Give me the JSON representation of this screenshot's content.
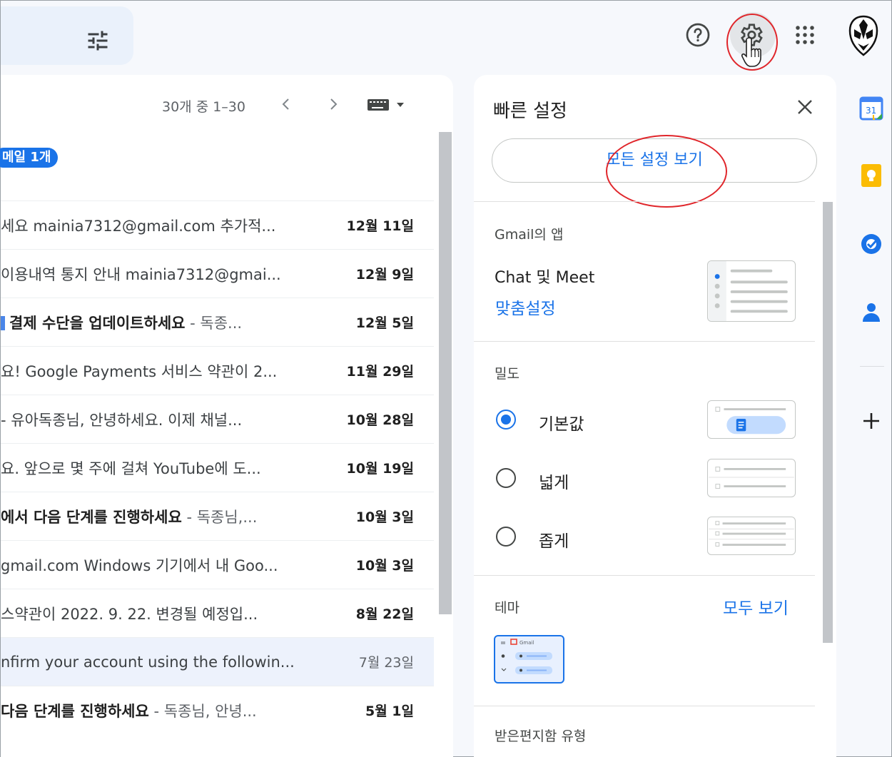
{
  "header": {
    "icons": [
      "tune-icon",
      "help-icon",
      "settings-gear-icon",
      "apps-grid-icon",
      "account-avatar"
    ]
  },
  "mail_list": {
    "pager_text": "30개 중 1–30",
    "new_badge": "메일 1개",
    "rows": [
      {
        "subject": "세요 mainia7312@gmail.com 추가적...",
        "date": "12월 11일",
        "bold": false,
        "highlight": false
      },
      {
        "subject": "이용내역 통지 안내 mainia7312@gmai...",
        "date": "12월 9일",
        "bold": false,
        "highlight": false
      },
      {
        "subject": "결제 수단을 업데이트하세요",
        "snippet": " - 독종...",
        "date": "12월 5일",
        "bold": true,
        "tag": true,
        "highlight": false
      },
      {
        "subject": "요! Google Payments 서비스 약관이 2...",
        "date": "11월 29일",
        "bold": false,
        "highlight": false
      },
      {
        "subject": "- 유아독종님, 안녕하세요. 이제 채널...",
        "date": "10월 28일",
        "bold": false,
        "highlight": false
      },
      {
        "subject": "요. 앞으로 몇 주에 걸쳐 YouTube에 도...",
        "date": "10월 19일",
        "bold": false,
        "highlight": false
      },
      {
        "subject": "에서 다음 단계를 진행하세요",
        "snippet": " - 독종님,...",
        "date": "10월 3일",
        "bold": true,
        "highlight": false
      },
      {
        "subject": "gmail.com Windows 기기에서 내 Goo...",
        "date": "10월 3일",
        "bold": false,
        "highlight": false
      },
      {
        "subject": "스약관이 2022. 9. 22. 변경될 예정입...",
        "date": "8월 22일",
        "bold": false,
        "highlight": false
      },
      {
        "subject": "nfirm your account using the followin...",
        "date": "7월 23일",
        "bold": false,
        "light_date": true,
        "highlight": true
      },
      {
        "subject": "다음 단계를 진행하세요",
        "snippet": " - 독종님, 안녕...",
        "date": "5월 1일",
        "bold": true,
        "highlight": false
      }
    ]
  },
  "quick_settings": {
    "title": "빠른 설정",
    "all_settings_button": "모든 설정 보기",
    "apps_section": {
      "label": "Gmail의 앱",
      "item": "Chat 및 Meet",
      "customize_link": "맞춤설정"
    },
    "density_section": {
      "label": "밀도",
      "options": [
        {
          "label": "기본값",
          "selected": true
        },
        {
          "label": "넓게",
          "selected": false
        },
        {
          "label": "좁게",
          "selected": false
        }
      ]
    },
    "theme_section": {
      "label": "테마",
      "view_all_link": "모두 보기",
      "thumb_title": "Gmail"
    },
    "inbox_type_label": "받은편지함 유형"
  },
  "side_rail": {
    "calendar_day": "31",
    "icons": [
      "calendar-icon",
      "keep-icon",
      "tasks-icon",
      "contacts-icon",
      "add-icon"
    ]
  },
  "colors": {
    "accent": "#1a73e8",
    "annotation_red": "#e0262b",
    "background": "#f6f8fc"
  }
}
